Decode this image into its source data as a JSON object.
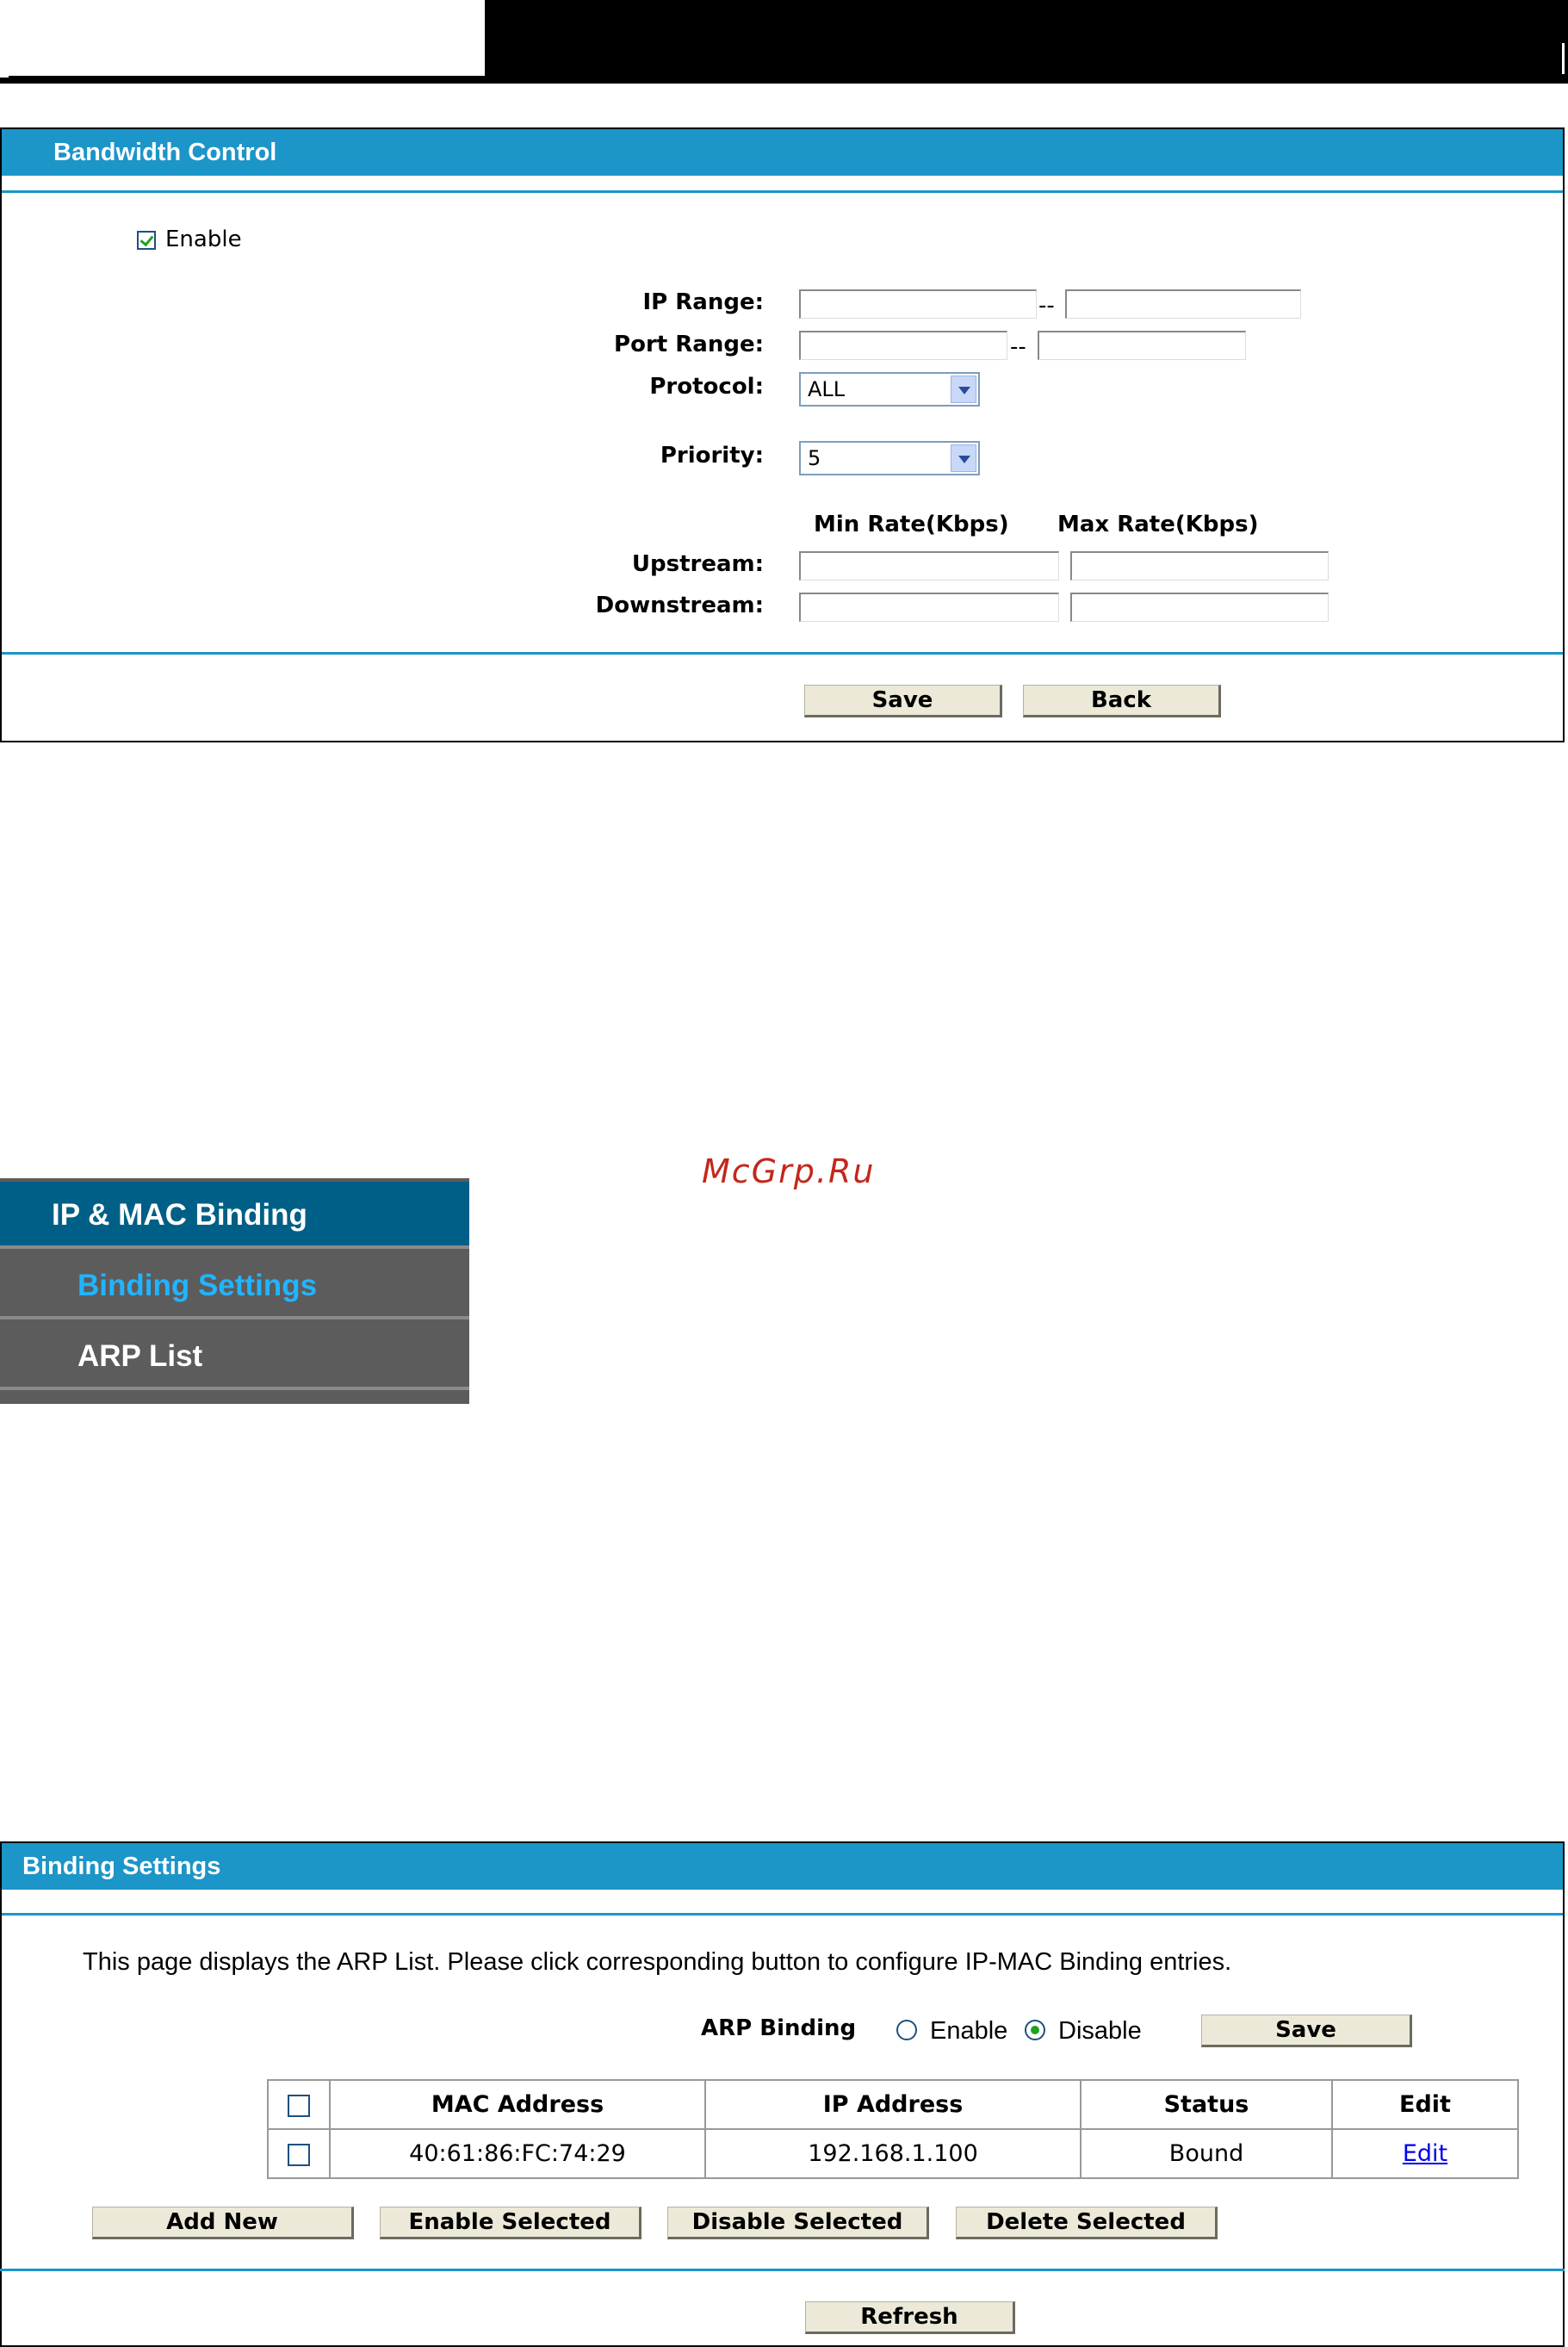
{
  "bandwidth": {
    "title": "Bandwidth Control",
    "enable_label": "Enable",
    "enable_checked": true,
    "ip_range_label": "IP Range:",
    "port_range_label": "Port Range:",
    "protocol_label": "Protocol:",
    "protocol_value": "ALL",
    "priority_label": "Priority:",
    "priority_value": "5",
    "range_sep": "--",
    "min_rate_header": "Min Rate(Kbps)",
    "max_rate_header": "Max Rate(Kbps)",
    "upstream_label": "Upstream:",
    "downstream_label": "Downstream:",
    "save_label": "Save",
    "back_label": "Back"
  },
  "watermark": "McGrp.Ru",
  "menu": {
    "header": "IP & MAC Binding",
    "items": [
      {
        "label": "Binding Settings",
        "active": true
      },
      {
        "label": "ARP List",
        "active": false
      }
    ]
  },
  "binding": {
    "title": "Binding Settings",
    "description": "This page displays the ARP List. Please click corresponding button to configure IP-MAC Binding entries.",
    "arp_binding_label": "ARP Binding",
    "enable_label": "Enable",
    "disable_label": "Disable",
    "selected": "Disable",
    "save_label": "Save",
    "table": {
      "headers": [
        "",
        "MAC Address",
        "IP Address",
        "Status",
        "Edit"
      ],
      "rows": [
        {
          "mac": "40:61:86:FC:74:29",
          "ip": "192.168.1.100",
          "status": "Bound",
          "edit": "Edit"
        }
      ]
    },
    "buttons": {
      "add_new": "Add New",
      "enable_selected": "Enable Selected",
      "disable_selected": "Disable Selected",
      "delete_selected": "Delete Selected",
      "refresh": "Refresh"
    }
  },
  "colors": {
    "header_blue": "#1c95c8",
    "menu_header": "#005f87",
    "menu_bg": "#5c5c5c",
    "menu_active_text": "#22b4ff",
    "link": "#0000ee"
  }
}
